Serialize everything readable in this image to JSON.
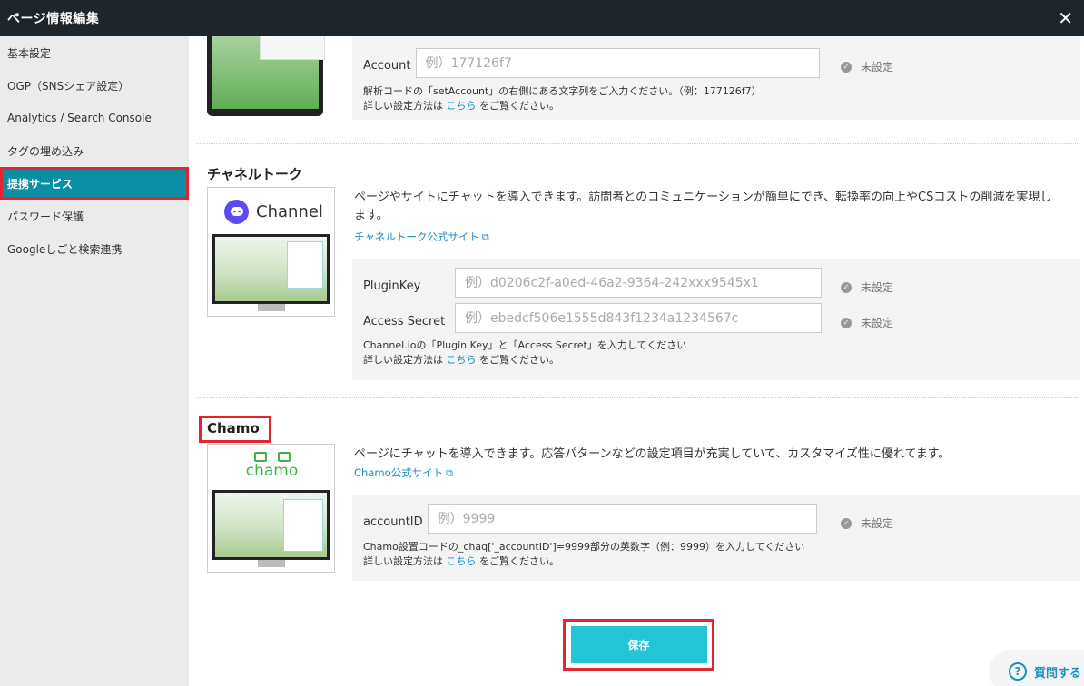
{
  "window": {
    "title": "ページ情報編集",
    "close_glyph": "✕"
  },
  "sidebar": {
    "items": [
      {
        "label": "基本設定"
      },
      {
        "label": "OGP（SNSシェア設定）"
      },
      {
        "label": "Analytics / Search Console"
      },
      {
        "label": "タグの埋め込み"
      },
      {
        "label": "提携サービス"
      },
      {
        "label": "パスワード保護"
      },
      {
        "label": "Googleしごと検索連携"
      }
    ]
  },
  "sections": {
    "top": {
      "account_label": "Account",
      "account_placeholder": "例）177126f7",
      "status": "未設定",
      "note_line1": "解析コードの「setAccount」の右側にある文字列をご入力ください。（例：177126f7）",
      "note_prefix": "詳しい設定方法は",
      "note_link": "こちら",
      "note_suffix": "をご覧ください。"
    },
    "channel": {
      "title": "チャネルトーク",
      "logo_text": "Channel",
      "description": "ページやサイトにチャットを導入できます。訪問者とのコミュニケーションが簡単にでき、転換率の向上やCSコストの削減を実現します。",
      "link": "チャネルトーク公式サイト",
      "plugin_label": "PluginKey",
      "plugin_placeholder": "例）d0206c2f-a0ed-46a2-9364-242xxx9545x1",
      "secret_label": "Access Secret",
      "secret_placeholder": "例）ebedcf506e1555d843f1234a1234567c",
      "status": "未設定",
      "note_line1": "Channel.ioの「Plugin Key」と「Access Secret」を入力してください",
      "note_prefix": "詳しい設定方法は",
      "note_link": "こちら",
      "note_suffix": "をご覧ください。"
    },
    "chamo": {
      "title": "Chamo",
      "logo_text": "chamo",
      "description": "ページにチャットを導入できます。応答パターンなどの設定項目が充実していて、カスタマイズ性に優れてます。",
      "link": "Chamo公式サイト",
      "account_label": "accountID",
      "account_placeholder": "例）9999",
      "status": "未設定",
      "note_line1": "Chamo設置コードの_chaq['_accountID']=9999部分の英数字（例：9999）を入力してください",
      "note_prefix": "詳しい設定方法は",
      "note_link": "こちら",
      "note_suffix": "をご覧ください。"
    }
  },
  "save_label": "保存",
  "help_label": "質問する",
  "colors": {
    "accent": "#25c3d6",
    "sidebar_active": "#0b8ea3",
    "highlight": "#e0262f",
    "link": "#1a8fc2"
  }
}
